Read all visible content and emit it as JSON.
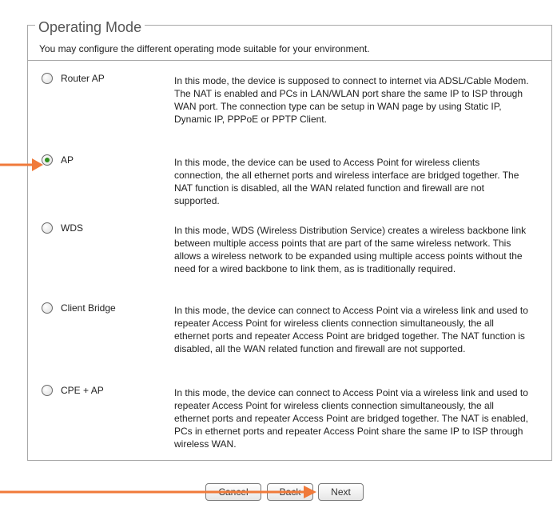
{
  "section": {
    "title": "Operating Mode",
    "subtitle": "You may configure the different operating mode suitable for your environment."
  },
  "options": [
    {
      "label": "Router AP",
      "selected": false,
      "description": "In this mode, the device is supposed to connect to internet via ADSL/Cable Modem. The NAT is enabled and PCs in LAN/WLAN port share the same IP to ISP through WAN port. The connection type can be setup in WAN page by using Static IP, Dynamic IP, PPPoE or PPTP Client."
    },
    {
      "label": "AP",
      "selected": true,
      "description": "In this mode, the device can be used to Access Point for wireless clients connection, the all ethernet ports and wireless interface are bridged together. The NAT function is disabled, all the WAN related function and firewall are not supported."
    },
    {
      "label": "WDS",
      "selected": false,
      "description": "In this mode, WDS (Wireless Distribution Service) creates a wireless backbone link between multiple access points that are part of the same wireless network. This allows a wireless network to be expanded using multiple access points without the need for a wired backbone to link them, as is traditionally required."
    },
    {
      "label": "Client Bridge",
      "selected": false,
      "description": "In this mode, the device can connect to Access Point via a wireless link and used to repeater Access Point for wireless clients connection simultaneously, the all ethernet ports and repeater Access Point are bridged together. The NAT function is disabled, all the WAN related function and firewall are not supported."
    },
    {
      "label": "CPE + AP",
      "selected": false,
      "description": "In this mode, the device can connect to Access Point via a wireless link and used to repeater Access Point for wireless clients connection simultaneously, the all ethernet ports and repeater Access Point are bridged together. The NAT is enabled, PCs in ethernet ports and repeater Access Point share the same IP to ISP through wireless WAN."
    }
  ],
  "buttons": {
    "cancel": "Cancel",
    "back": "Back",
    "next": "Next"
  },
  "colors": {
    "annotation_arrow": "#f07a3a",
    "radio_checked": "#2f8f1f"
  }
}
